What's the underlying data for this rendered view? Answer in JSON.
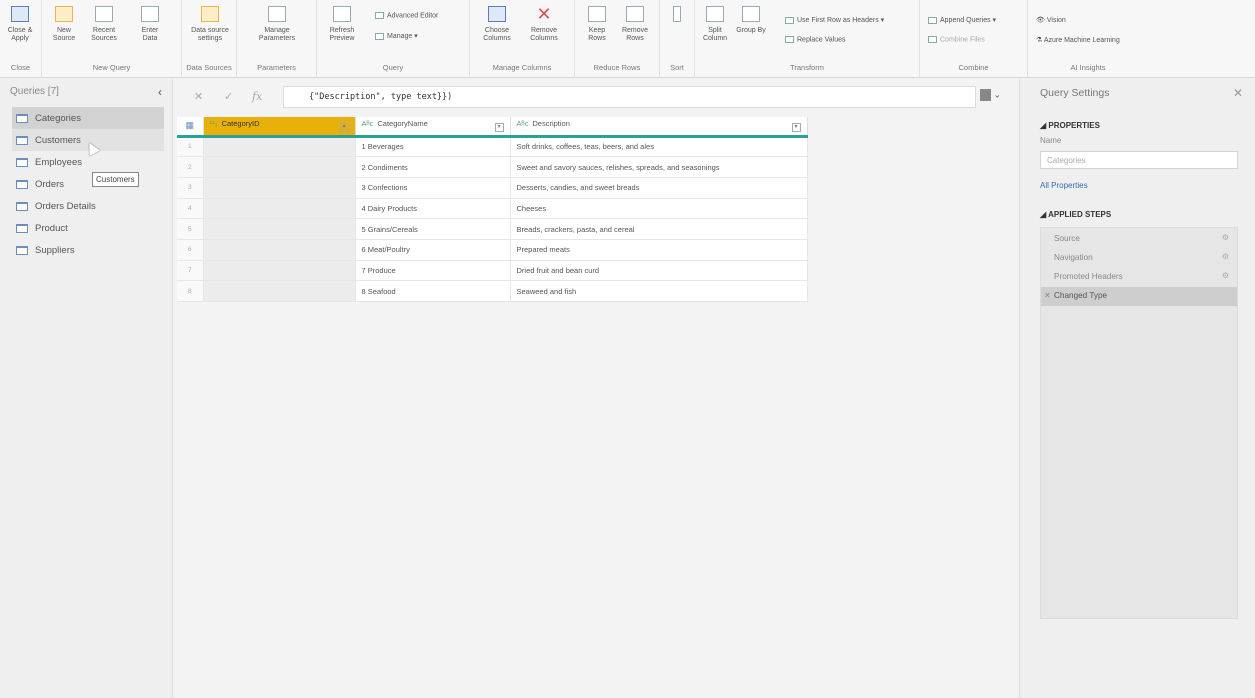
{
  "ribbon": {
    "groups": [
      {
        "label": "Close",
        "buttons": [
          "Close & Apply"
        ]
      },
      {
        "label": "New Query",
        "buttons": [
          "New Source",
          "Recent Sources",
          "Enter Data"
        ]
      },
      {
        "label": "Data Sources",
        "buttons": [
          "Data source settings"
        ]
      },
      {
        "label": "Parameters",
        "buttons": [
          "Manage Parameters"
        ]
      },
      {
        "label": "Query",
        "buttons": [
          "Refresh Preview"
        ],
        "small": [
          "Advanced Editor",
          "Manage"
        ]
      },
      {
        "label": "Manage Columns",
        "buttons": [
          "Choose Columns",
          "Remove Columns"
        ]
      },
      {
        "label": "Reduce Rows",
        "buttons": [
          "Keep Rows",
          "Remove Rows"
        ]
      },
      {
        "label": "Sort",
        "buttons": []
      },
      {
        "label": "Transform",
        "buttons": [
          "Split Column",
          "Group By"
        ],
        "small": [
          "Use First Row as Headers",
          "Replace Values"
        ]
      },
      {
        "label": "Combine",
        "small": [
          "Append Queries",
          "Combine Files"
        ]
      },
      {
        "label": "AI Insights",
        "small": [
          "Vision",
          "Azure Machine Learning"
        ]
      }
    ]
  },
  "queries": {
    "header": "Queries [7]",
    "items": [
      "Categories",
      "Customers",
      "Employees",
      "Orders",
      "Orders Details",
      "Product",
      "Suppliers"
    ],
    "selected": "Categories",
    "tooltip": "Customers"
  },
  "formula": {
    "text": "{\"Description\", type text}})"
  },
  "grid": {
    "columns": [
      "CategoryID",
      "CategoryName",
      "Description"
    ],
    "rows": [
      {
        "n": "1",
        "id": "1",
        "name": "Beverages",
        "desc": "Soft drinks, coffees, teas, beers, and ales"
      },
      {
        "n": "2",
        "id": "2",
        "name": "Condiments",
        "desc": "Sweet and savory sauces, relishes, spreads, and seasonings"
      },
      {
        "n": "3",
        "id": "3",
        "name": "Confections",
        "desc": "Desserts, candies, and sweet breads"
      },
      {
        "n": "4",
        "id": "4",
        "name": "Dairy Products",
        "desc": "Cheeses"
      },
      {
        "n": "5",
        "id": "5",
        "name": "Grains/Cereals",
        "desc": "Breads, crackers, pasta, and cereal"
      },
      {
        "n": "6",
        "id": "6",
        "name": "Meat/Poultry",
        "desc": "Prepared meats"
      },
      {
        "n": "7",
        "id": "7",
        "name": "Produce",
        "desc": "Dried fruit and bean curd"
      },
      {
        "n": "8",
        "id": "8",
        "name": "Seafood",
        "desc": "Seaweed and fish"
      }
    ]
  },
  "settings": {
    "title": "Query Settings",
    "properties_header": "PROPERTIES",
    "name_label": "Name",
    "name_value": "Categories",
    "all_properties": "All Properties",
    "steps_header": "APPLIED STEPS",
    "steps": [
      "Source",
      "Navigation",
      "Promoted Headers",
      "Changed Type"
    ]
  }
}
